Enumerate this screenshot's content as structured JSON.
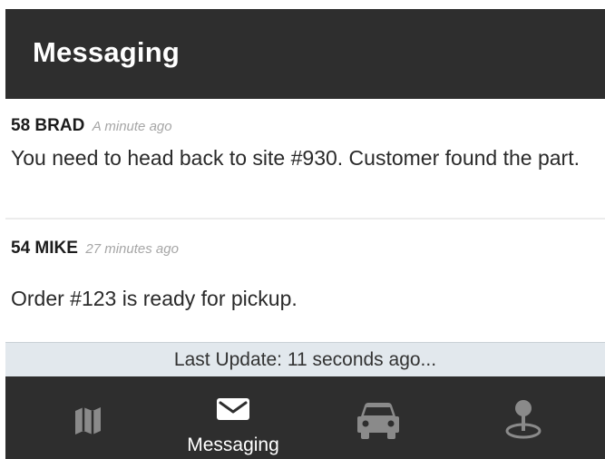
{
  "header": {
    "title": "Messaging"
  },
  "messages": [
    {
      "sender": "58 BRAD",
      "time": "A minute ago",
      "body": "You need to head back to site #930. Customer found the part."
    },
    {
      "sender": "54 MIKE",
      "time": "27 minutes ago",
      "body": "Order #123 is ready for pickup."
    }
  ],
  "status": {
    "text": "Last Update: 11 seconds ago..."
  },
  "tabbar": {
    "tabs": [
      {
        "icon": "map-icon",
        "label": "",
        "active": false
      },
      {
        "icon": "envelope-icon",
        "label": "Messaging",
        "active": true
      },
      {
        "icon": "car-icon",
        "label": "",
        "active": false
      },
      {
        "icon": "location-pin-icon",
        "label": "",
        "active": false
      }
    ]
  },
  "colors": {
    "header_bg": "#2e2e2e",
    "tabbar_bg": "#2e2e2e",
    "status_bg": "#e2e8ed",
    "active_icon": "#ffffff",
    "inactive_icon": "#8a8a8a",
    "time_text": "#a6a6a6"
  }
}
